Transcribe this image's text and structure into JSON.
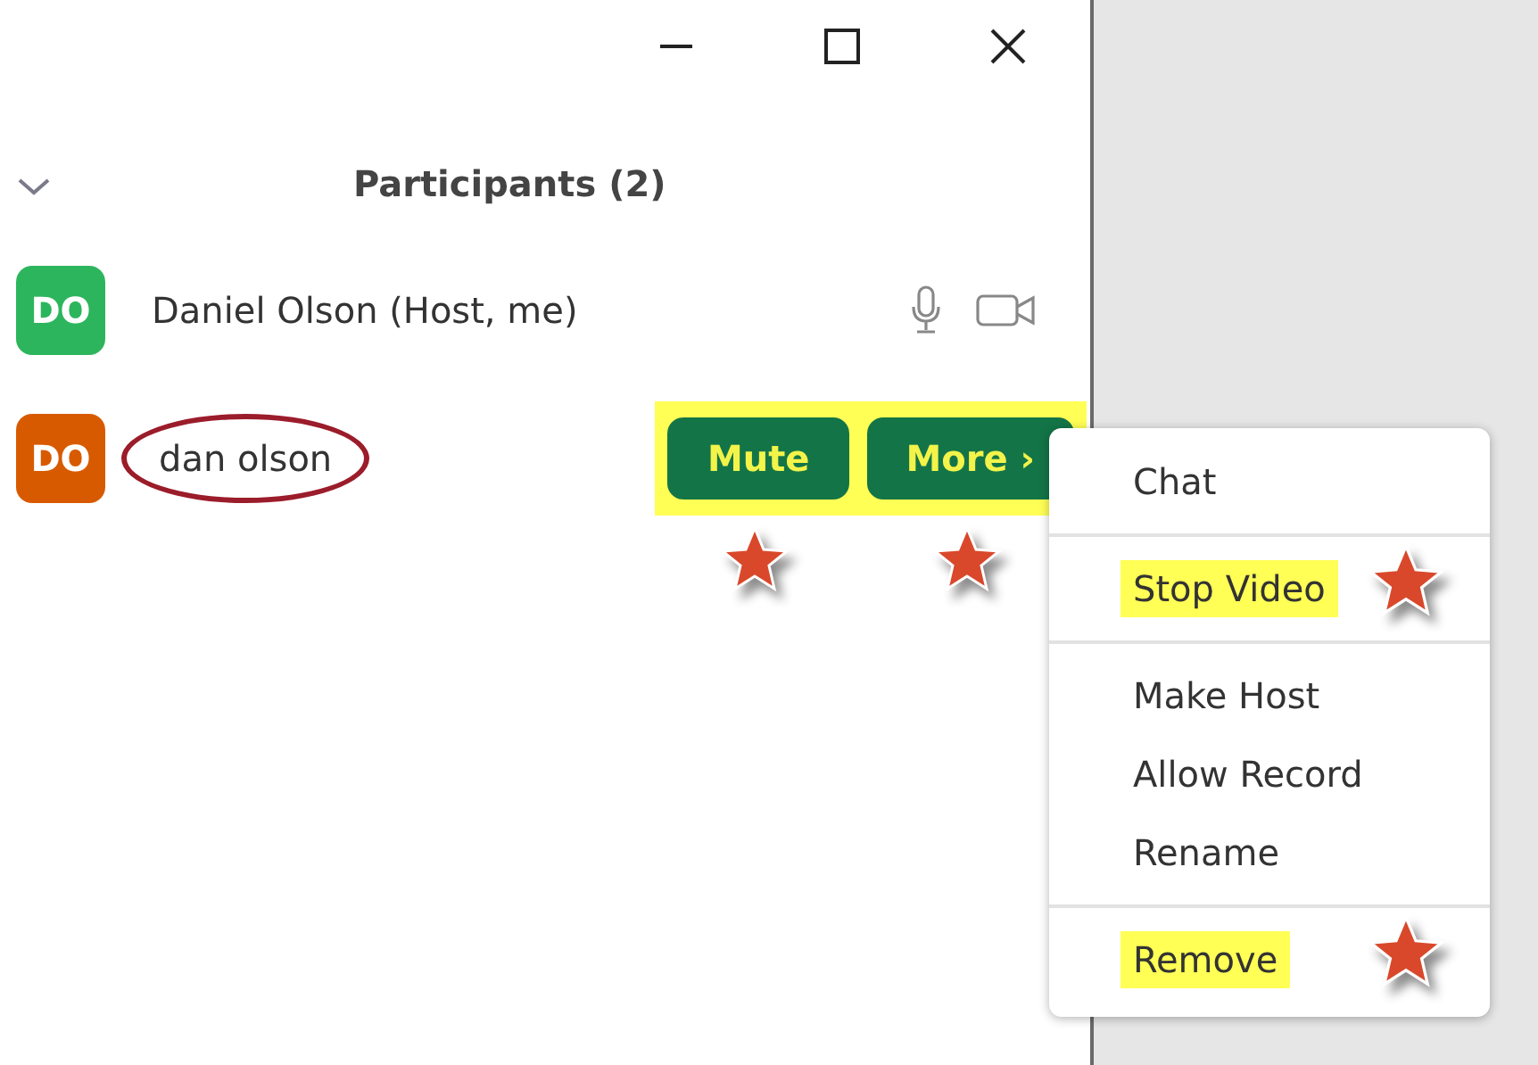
{
  "header": {
    "title": "Participants (2)"
  },
  "participants": [
    {
      "kind": "self",
      "initials": "DO",
      "name": "Daniel Olson (Host, me)",
      "color": "#2db55d",
      "circled": false
    },
    {
      "kind": "hover",
      "initials": "DO",
      "name": "dan olson",
      "color": "#d85a00",
      "circled": true
    }
  ],
  "actions": {
    "highlighted": true,
    "buttons": [
      {
        "label": "Mute",
        "starred": true
      },
      {
        "label": "More ›",
        "starred": true
      }
    ]
  },
  "menu": {
    "items": [
      {
        "label": "Chat",
        "highlighted": false,
        "starred": false,
        "divider_after": true
      },
      {
        "label": "Stop Video",
        "highlighted": true,
        "starred": true,
        "divider_after": true
      },
      {
        "label": "Make Host",
        "highlighted": false,
        "starred": false,
        "divider_after": false
      },
      {
        "label": "Allow Record",
        "highlighted": false,
        "starred": false,
        "divider_after": false
      },
      {
        "label": "Rename",
        "highlighted": false,
        "starred": false,
        "divider_after": true
      },
      {
        "label": "Remove",
        "highlighted": true,
        "starred": true,
        "divider_after": false
      }
    ]
  }
}
